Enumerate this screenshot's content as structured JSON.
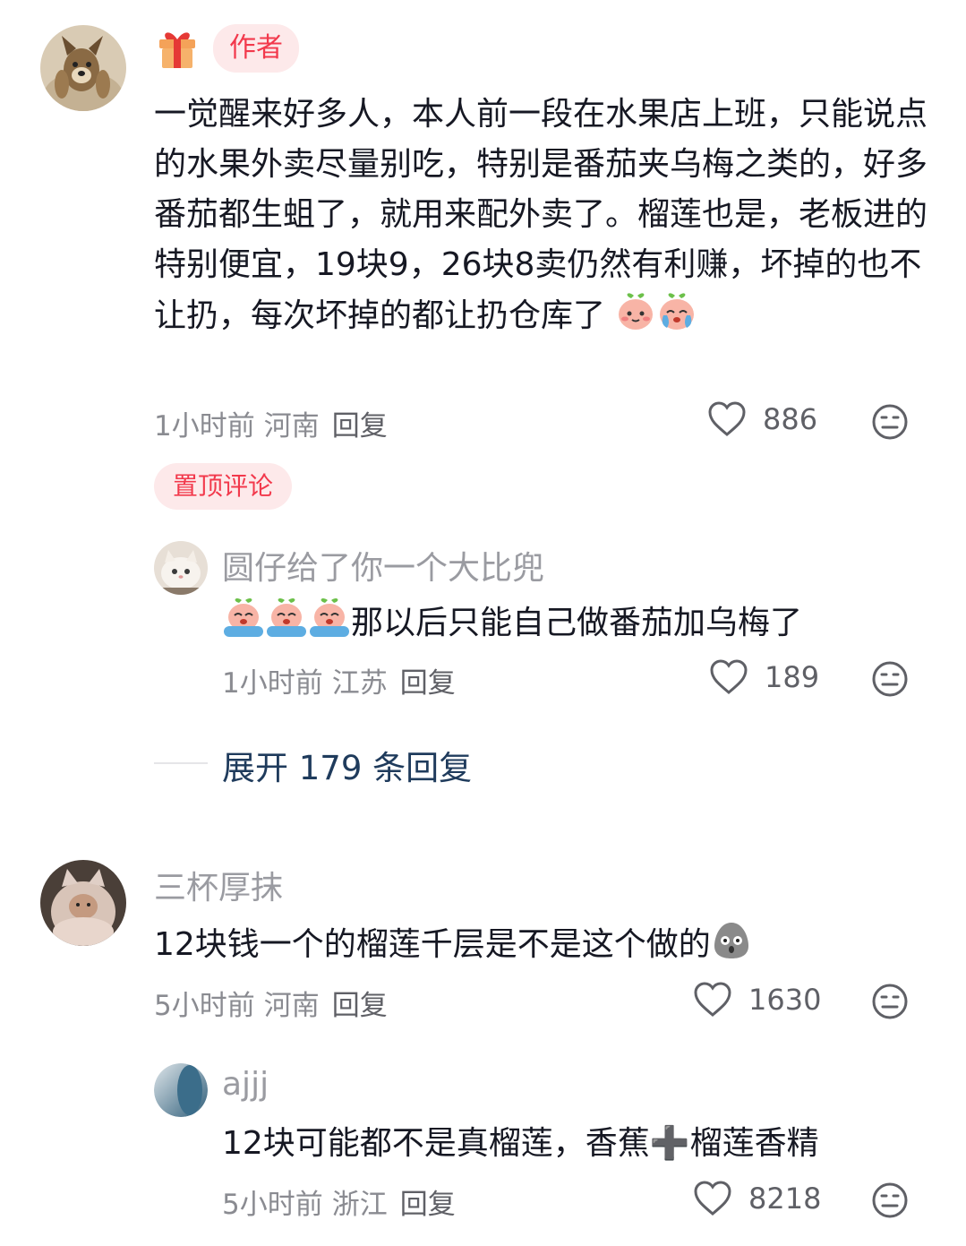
{
  "comments": [
    {
      "author_tag": "作者",
      "text": "一觉醒来好多人，本人前一段在水果店上班，只能说点的水果外卖尽量别吃，特别是番茄夹乌梅之类的，好多番茄都生蛆了，就用来配外卖了。榴莲也是，老板进的特别便宜，19块9，26块8卖仍然有利赚，坏掉的也不让扔，每次坏掉的都让扔仓库了",
      "time": "1小时前",
      "location": "河南",
      "reply_label": "回复",
      "likes": "886",
      "pinned_label": "置顶评论",
      "reply": {
        "username": "圆仔给了你一个大比兜",
        "text": "那以后只能自己做番茄加乌梅了",
        "time": "1小时前",
        "location": "江苏",
        "reply_label": "回复",
        "likes": "189"
      },
      "expand_label": "展开 179 条回复"
    },
    {
      "username": "三杯厚抹",
      "text": "12块钱一个的榴莲千层是不是这个做的",
      "time": "5小时前",
      "location": "河南",
      "reply_label": "回复",
      "likes": "1630",
      "reply": {
        "username": "ajjj",
        "text": "12块可能都不是真榴莲，香蕉➕榴莲香精",
        "time": "5小时前",
        "location": "浙江",
        "reply_label": "回复",
        "likes": "8218"
      }
    }
  ],
  "icons": {
    "author_badge": "gift-icon",
    "like": "heart-outline-icon",
    "dislike": "meh-face-icon"
  },
  "colors": {
    "text": "#161823",
    "muted": "#8a8b91",
    "tag_bg": "#fde9ea",
    "tag_text": "#f2394c",
    "link": "#1f3b5c"
  }
}
